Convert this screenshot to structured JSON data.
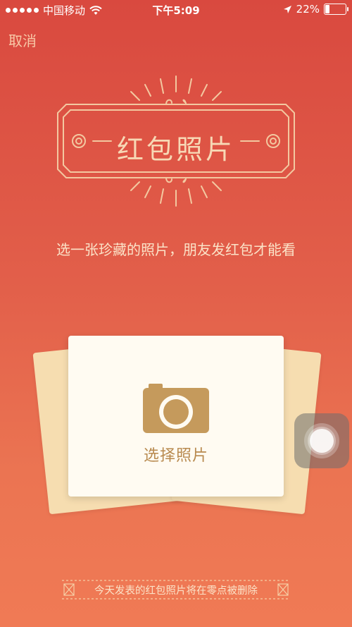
{
  "status_bar": {
    "carrier": "中国移动",
    "time": "下午5:09",
    "battery_text": "22%",
    "battery_level": 0.22
  },
  "nav": {
    "cancel_label": "取消"
  },
  "header": {
    "title": "红包照片"
  },
  "main": {
    "description": "选一张珍藏的照片，朋友发红包才能看",
    "choose_label": "选择照片"
  },
  "footer": {
    "notice": "今天发表的红包照片将在零点被删除"
  },
  "colors": {
    "background_top": "#d9493f",
    "background_bottom": "#f07a55",
    "accent_gold": "#b88a4f",
    "card_front": "#fffbf2",
    "card_back": "#f6ddb0",
    "title_text": "#f7d8b5"
  },
  "icons": {
    "signal": "signal-dots-icon",
    "wifi": "wifi-icon",
    "location": "location-arrow-icon",
    "battery": "battery-icon",
    "camera": "camera-icon",
    "assistive": "assistive-touch-icon"
  }
}
